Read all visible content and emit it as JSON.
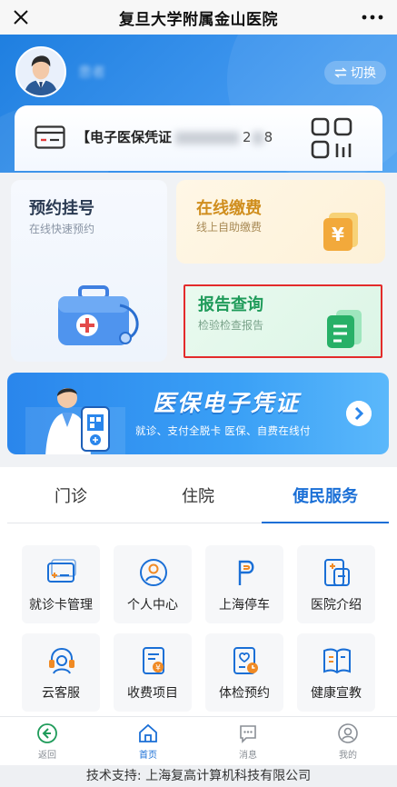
{
  "titlebar": {
    "title": "复旦大学附属金山医院",
    "close_icon": "close-icon",
    "more_icon": "more-icon"
  },
  "profile": {
    "username": "患者",
    "switch_label": "切换",
    "card_label": "【电子医保凭证",
    "card_number_tail": "2",
    "card_number_end": "8"
  },
  "services": {
    "appointment": {
      "title": "预约挂号",
      "subtitle": "在线快速预约"
    },
    "payment": {
      "title": "在线缴费",
      "subtitle": "线上自助缴费"
    },
    "report": {
      "title": "报告查询",
      "subtitle": "检验检查报告"
    }
  },
  "banner": {
    "title": "医保电子凭证",
    "subtitle": "就诊、支付全脱卡  医保、自费在线付"
  },
  "tabs": [
    {
      "label": "门诊"
    },
    {
      "label": "住院"
    },
    {
      "label": "便民服务"
    }
  ],
  "active_tab": "便民服务",
  "grid": [
    {
      "label": "就诊卡管理",
      "icon": "card-icon"
    },
    {
      "label": "个人中心",
      "icon": "person-icon"
    },
    {
      "label": "上海停车",
      "icon": "parking-icon"
    },
    {
      "label": "医院介绍",
      "icon": "hospital-info-icon"
    },
    {
      "label": "云客服",
      "icon": "headset-icon"
    },
    {
      "label": "收费项目",
      "icon": "fee-icon"
    },
    {
      "label": "体检预约",
      "icon": "checkup-icon"
    },
    {
      "label": "健康宣教",
      "icon": "book-icon"
    }
  ],
  "bottom_nav": [
    {
      "label": "返回",
      "icon": "back-icon"
    },
    {
      "label": "首页",
      "icon": "home-icon"
    },
    {
      "label": "消息",
      "icon": "message-icon"
    },
    {
      "label": "我的",
      "icon": "user-icon"
    }
  ],
  "footer": "技术支持: 上海复高计算机科技有限公司",
  "colors": {
    "primary": "#1a6fd6",
    "pay": "#d08e1e",
    "report": "#1f9b5a",
    "highlight": "#e32b2b"
  }
}
